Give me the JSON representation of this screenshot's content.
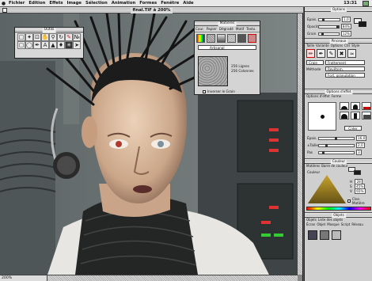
{
  "menubar": {
    "apple_icon": "apple-icon",
    "menus": [
      "Fichier",
      "Edition",
      "Effets",
      "Image",
      "Sélection",
      "Animation",
      "Formes",
      "Fenêtre",
      "Aide"
    ],
    "clock": "13:31"
  },
  "document": {
    "title": "final.TIF à 200%"
  },
  "tools_palette": {
    "title": "Outils"
  },
  "textures_palette": {
    "title": "Matières",
    "tabs": [
      "Cour.",
      "Papier",
      "Dégradé",
      "Motif",
      "Textu."
    ],
    "selected_paper": "Artisanal",
    "lines": "256 Lignes",
    "columns": "256 Colonnes",
    "invert_label": "Inverser le Grain"
  },
  "right_panel": {
    "controls_title": "Options",
    "controls_tabs": [
      "Options",
      "Pinceau"
    ],
    "sliders": [
      {
        "label": "Épais.",
        "value": "1,0"
      },
      {
        "label": "Opacité",
        "value": "84%"
      },
      {
        "label": "Grain",
        "value": "12%"
      }
    ],
    "brushes_title": "Pinceaux",
    "brush_tabs": [
      "Taille",
      "Variante",
      "Options",
      "Ctrl",
      "Style"
    ],
    "method_label": "Craie",
    "method_value": "Frottement",
    "subcat_label": "Méthode",
    "subcat_value": "Revêtem.",
    "subcat2_value": "Fort, granulation",
    "size_title": "Options d'effet",
    "size_tabs": [
      "Options d'effet",
      "Forme"
    ],
    "size_rows": [
      {
        "label": "Épais.",
        "value": "16,0"
      },
      {
        "label": "±Taille",
        "value": "2,0"
      },
      {
        "label": "Pas",
        "value": "3"
      }
    ],
    "build_label": "Créer",
    "color_title": "Couleur",
    "color_tabs": [
      "Matières",
      "Barre de couleur"
    ],
    "color_label": "Couleur",
    "h_value": "28",
    "s_value": "45%",
    "v_value": "65%",
    "clone_label": "Clon. Matière",
    "color_chips": {
      "primary": "#efefef",
      "secondary": "#1a1a1a"
    },
    "objects_title": "Objets",
    "objects_tabs": [
      "Objets",
      "Liste des objets"
    ],
    "objects_subtabs": [
      "Écran",
      "Objet",
      "Masque",
      "Script",
      "Réseau"
    ]
  },
  "status": {
    "zoom": "200%"
  }
}
